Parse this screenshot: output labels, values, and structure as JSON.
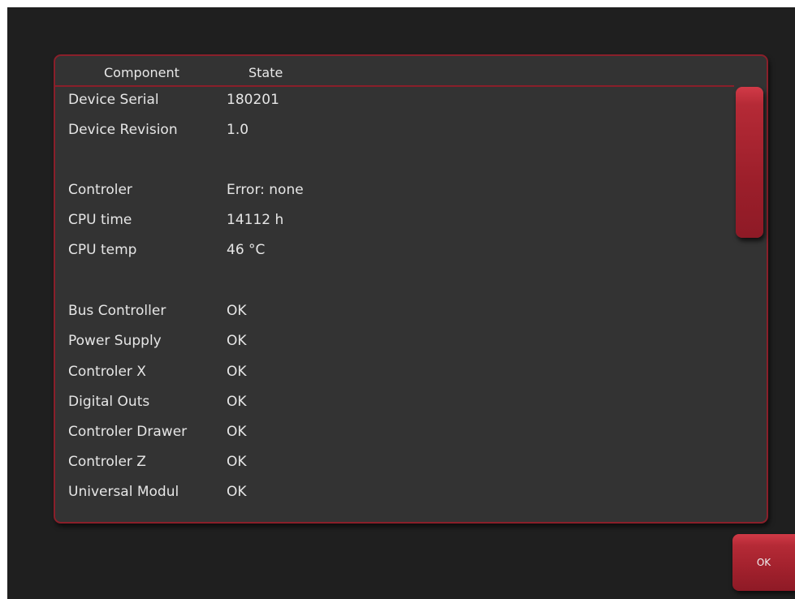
{
  "table": {
    "headers": {
      "component": "Component",
      "state": "State"
    },
    "rows": [
      {
        "component": "Device Serial",
        "state": "180201"
      },
      {
        "component": "Device Revision",
        "state": "1.0"
      },
      {
        "component": "",
        "state": ""
      },
      {
        "component": "Controler",
        "state": "Error: none"
      },
      {
        "component": "CPU time",
        "state": "14112 h"
      },
      {
        "component": "CPU temp",
        "state": "46 °C"
      },
      {
        "component": "",
        "state": ""
      },
      {
        "component": "Bus Controller",
        "state": "OK"
      },
      {
        "component": "Power Supply",
        "state": "OK"
      },
      {
        "component": "Controler X",
        "state": "OK"
      },
      {
        "component": "Digital Outs",
        "state": "OK"
      },
      {
        "component": "Controler Drawer",
        "state": "OK"
      },
      {
        "component": "Controler Z",
        "state": "OK"
      },
      {
        "component": "Universal Modul",
        "state": "OK"
      }
    ]
  },
  "footer": {
    "ok_label": "OK"
  },
  "colors": {
    "accent": "#9d1f2b",
    "panel": "#333333",
    "background": "#1f1f1f"
  }
}
